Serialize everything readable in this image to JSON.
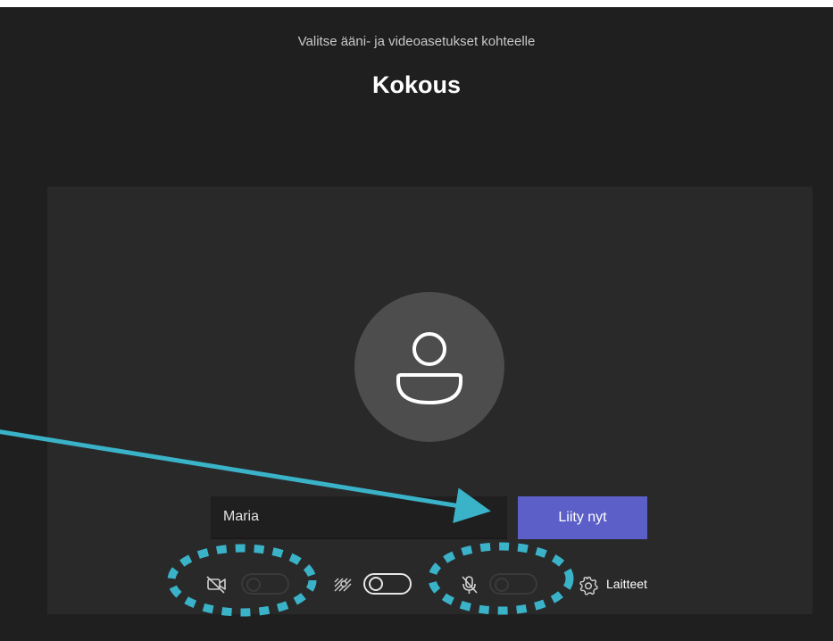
{
  "header": {
    "subtitle": "Valitse ääni- ja videoasetukset kohteelle",
    "title": "Kokous"
  },
  "prejoin": {
    "avatar_icon": "person-icon",
    "name_value": "Maria",
    "join_label": "Liity nyt"
  },
  "controls": {
    "camera": {
      "icon": "camera-off-icon",
      "on": false,
      "enabled": false
    },
    "background_effects": {
      "icon": "background-effects-icon",
      "on": false,
      "enabled": true
    },
    "microphone": {
      "icon": "microphone-off-icon",
      "on": false,
      "enabled": false
    },
    "devices": {
      "icon": "gear-icon",
      "label": "Laitteet"
    }
  },
  "colors": {
    "background": "#1f1f1f",
    "panel": "#292929",
    "accent": "#5b5fc7",
    "annotation": "#3ab3c9"
  }
}
